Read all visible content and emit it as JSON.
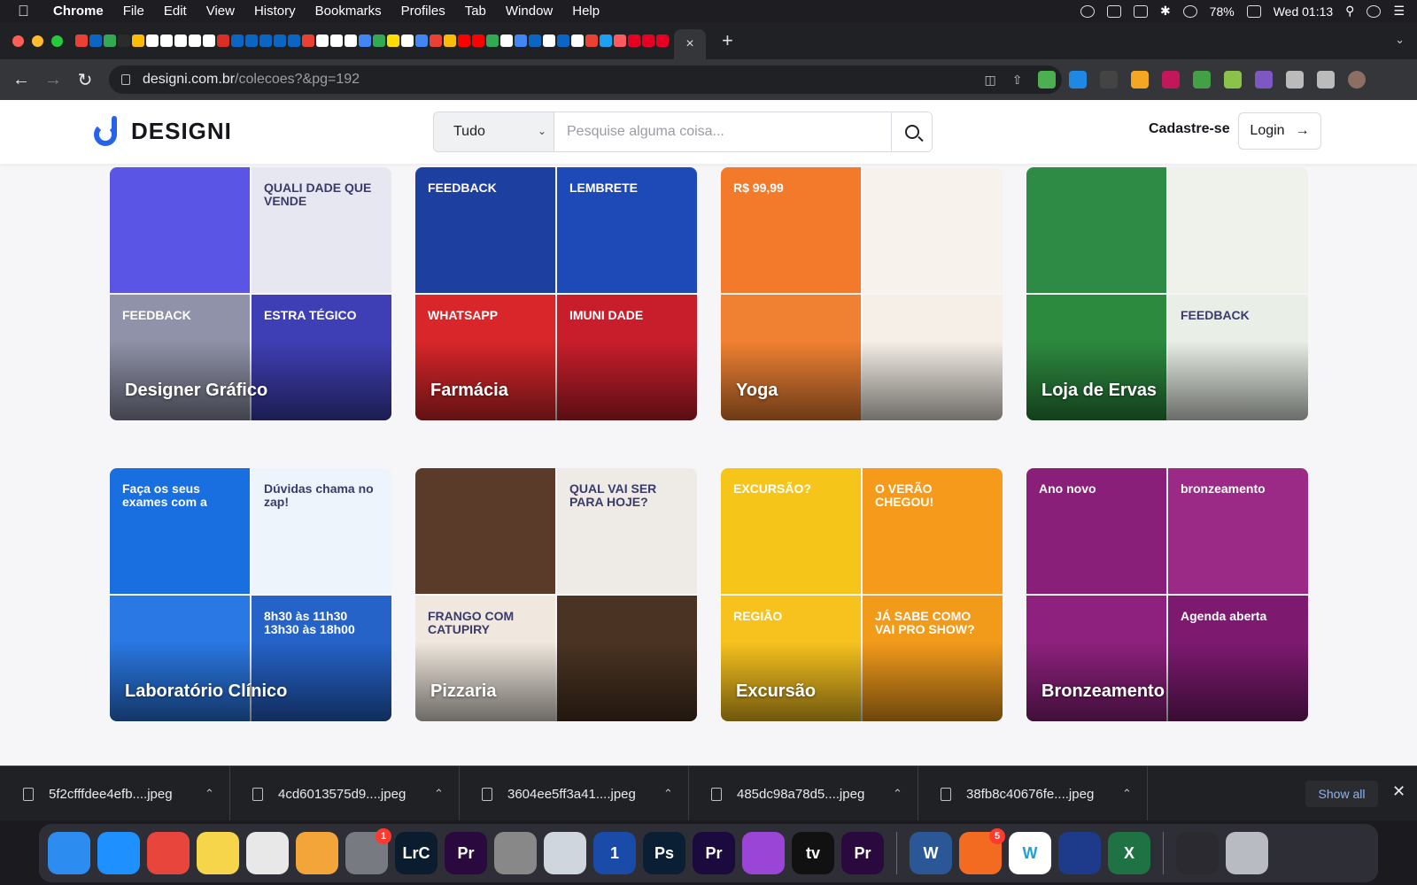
{
  "menubar": {
    "app_name": "Chrome",
    "items": [
      "File",
      "Edit",
      "View",
      "History",
      "Bookmarks",
      "Profiles",
      "Tab",
      "Window",
      "Help"
    ],
    "battery": "78%",
    "clock": "Wed 01:13"
  },
  "browser": {
    "url_host": "designi.com.br",
    "url_path": "/colecoes?&pg=192",
    "active_tab_close": "×",
    "new_tab": "+"
  },
  "site": {
    "logo_text": "DESIGNI",
    "search_category": "Tudo",
    "search_placeholder": "Pesquise alguma coisa...",
    "signup_label": "Cadastre-se",
    "login_label": "Login"
  },
  "collections": [
    {
      "title": "Designer Gráfico",
      "colors": [
        "#5b55e6",
        "#e7e7f1",
        "#8f92a8",
        "#3f3fb5"
      ],
      "deco": [
        "",
        "QUALI DADE QUE VENDE",
        "FEEDBACK",
        "ESTRA TÉGICO"
      ]
    },
    {
      "title": "Farmácia",
      "colors": [
        "#1d3fa0",
        "#1e4ab8",
        "#d8262a",
        "#c81e2c"
      ],
      "deco": [
        "FEEDBACK",
        "LEMBRETE",
        "WHATSAPP",
        "IMUNI DADE"
      ]
    },
    {
      "title": "Yoga",
      "colors": [
        "#f27a2a",
        "#f7f2ec",
        "#f08133",
        "#f5efe7"
      ],
      "deco": [
        "R$ 99,99",
        "",
        "",
        ""
      ]
    },
    {
      "title": "Loja de Ervas",
      "colors": [
        "#2e8b46",
        "#eef2ea",
        "#2c8a3f",
        "#e9efe6"
      ],
      "deco": [
        "",
        "",
        "",
        "FEEDBACK"
      ]
    },
    {
      "title": "Laboratório Clínico",
      "colors": [
        "#1a6fe0",
        "#eef4fb",
        "#2a78e4",
        "#2563c9"
      ],
      "deco": [
        "Faça os seus exames com a",
        "Dúvidas chama no zap!",
        "",
        "8h30 às 11h30 13h30 às 18h00"
      ]
    },
    {
      "title": "Pizzaria",
      "colors": [
        "#5a3a28",
        "#eeeae6",
        "#f0e8de",
        "#4a3322"
      ],
      "deco": [
        "",
        "QUAL VAI SER PARA HOJE?",
        "FRANGO COM CATUPIRY",
        ""
      ]
    },
    {
      "title": "Excursão",
      "colors": [
        "#f6c51a",
        "#f59a1a",
        "#f7c21e",
        "#f29b1b"
      ],
      "deco": [
        "EXCURSÃO?",
        "O VERÃO CHEGOU!",
        "REGIÃO",
        "JÁ SABE COMO VAI PRO SHOW?"
      ]
    },
    {
      "title": "Bronzeamento",
      "colors": [
        "#8a1f7a",
        "#9a2a86",
        "#8e217d",
        "#7d1a70"
      ],
      "deco": [
        "Ano novo",
        "bronzeamento",
        "",
        "Agenda aberta"
      ]
    }
  ],
  "downloads": [
    {
      "name": "5f2cfffdee4efb....jpeg"
    },
    {
      "name": "4cd6013575d9....jpeg"
    },
    {
      "name": "3604ee5ff3a41....jpeg"
    },
    {
      "name": "485dc98a78d5....jpeg"
    },
    {
      "name": "38fb8c40676fe....jpeg"
    }
  ],
  "downloads_show_all": "Show all",
  "dock": {
    "apps": [
      {
        "name": "finder-icon",
        "color": "#2d8cf0",
        "label": ""
      },
      {
        "name": "safari-icon",
        "color": "#1e90ff",
        "label": ""
      },
      {
        "name": "chrome-icon",
        "color": "#e8453c",
        "label": ""
      },
      {
        "name": "notes-icon",
        "color": "#f7d54a",
        "label": ""
      },
      {
        "name": "textedit-icon",
        "color": "#e8e8e8",
        "label": ""
      },
      {
        "name": "photos-icon",
        "color": "#f4a53a",
        "label": ""
      },
      {
        "name": "system-preferences-icon",
        "color": "#777a80",
        "label": "",
        "badge": "1"
      },
      {
        "name": "lightroom-icon",
        "color": "#0a1c2e",
        "label": "LrC"
      },
      {
        "name": "premiere-icon",
        "color": "#2a0a3e",
        "label": "Pr"
      },
      {
        "name": "disk-utility-icon",
        "color": "#888888",
        "label": ""
      },
      {
        "name": "preview-icon",
        "color": "#cfd6dd",
        "label": ""
      },
      {
        "name": "onepassword-icon",
        "color": "#1a4ba8",
        "label": "1"
      },
      {
        "name": "photoshop-icon",
        "color": "#0a1f33",
        "label": "Ps"
      },
      {
        "name": "premiere-pro-icon",
        "color": "#1a0a3e",
        "label": "Pr"
      },
      {
        "name": "podcasts-icon",
        "color": "#9b45d6",
        "label": ""
      },
      {
        "name": "apple-tv-icon",
        "color": "#111111",
        "label": "tv"
      },
      {
        "name": "premiere-rush-icon",
        "color": "#2a0a3e",
        "label": "Pr"
      },
      {
        "name": "word-icon",
        "color": "#2b5797",
        "label": "W"
      },
      {
        "name": "app-store-icon",
        "color": "#f36b21",
        "label": "",
        "badge": "5"
      },
      {
        "name": "wunderlist-icon",
        "color": "#ffffff",
        "label": "W"
      },
      {
        "name": "dock-app-icon",
        "color": "#1e3a8a",
        "label": ""
      },
      {
        "name": "excel-icon",
        "color": "#1f7244",
        "label": "X"
      },
      {
        "name": "screenshots-icon",
        "color": "#2a2a30",
        "label": ""
      },
      {
        "name": "trash-icon",
        "color": "#b8bcc2",
        "label": ""
      }
    ]
  }
}
